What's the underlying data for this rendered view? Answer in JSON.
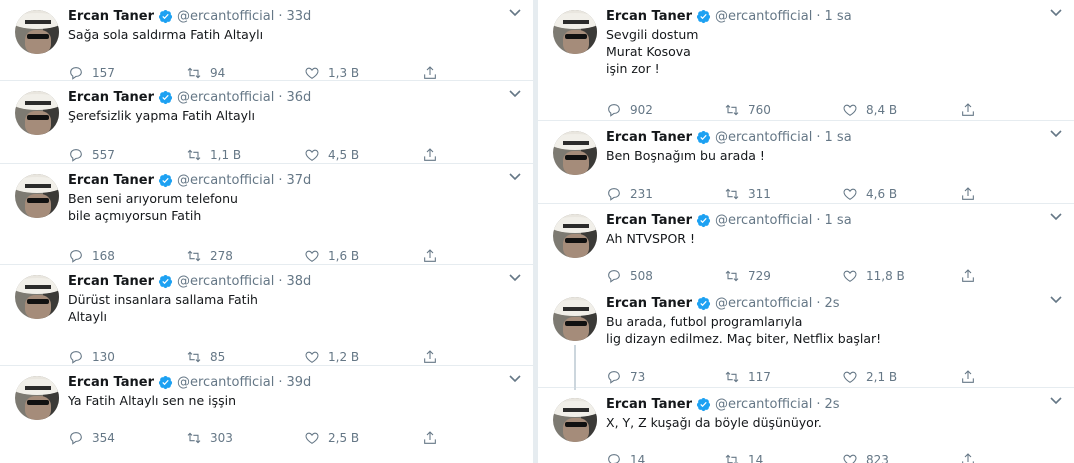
{
  "author": {
    "name": "Ercan Taner",
    "handle": "@ercantofficial"
  },
  "colors": {
    "verified": "#1da1f2",
    "muted": "#657786",
    "text": "#14171a",
    "divider": "#e6ecf0"
  },
  "left_tweets": [
    {
      "time": "33d",
      "text": "Sağa sola saldırma Fatih Altaylı",
      "replies": "157",
      "retweets": "94",
      "likes": "1,3 B"
    },
    {
      "time": "36d",
      "text": "Şerefsizlik yapma  Fatih Altaylı",
      "replies": "557",
      "retweets": "1,1 B",
      "likes": "4,5 B"
    },
    {
      "time": "37d",
      "text": "Ben seni arıyorum telefonu\nbile açmıyorsun Fatih",
      "replies": "168",
      "retweets": "278",
      "likes": "1,6 B"
    },
    {
      "time": "38d",
      "text": "Dürüst insanlara sallama Fatih\nAltaylı",
      "replies": "130",
      "retweets": "85",
      "likes": "1,2 B"
    },
    {
      "time": "39d",
      "text": "Ya Fatih  Altaylı sen ne işşin",
      "replies": "354",
      "retweets": "303",
      "likes": "2,5 B"
    }
  ],
  "right_tweets": [
    {
      "time": "1 sa",
      "text": "Sevgili dostum\nMurat Kosova\nişin zor !",
      "replies": "902",
      "retweets": "760",
      "likes": "8,4 B"
    },
    {
      "time": "1 sa",
      "text": "Ben Boşnağım bu arada !",
      "replies": "231",
      "retweets": "311",
      "likes": "4,6 B"
    },
    {
      "time": "1 sa",
      "text": "Ah NTVSPOR  !",
      "replies": "508",
      "retweets": "729",
      "likes": "11,8 B"
    },
    {
      "time": "2s",
      "text": "Bu arada, futbol programlarıyla\nlig dizayn edilmez. Maç biter, Netflix başlar!",
      "replies": "73",
      "retweets": "117",
      "likes": "2,1 B"
    },
    {
      "time": "2s",
      "text": "X, Y, Z kuşağı da böyle düşünüyor.",
      "replies": "14",
      "retweets": "14",
      "likes": "823"
    }
  ]
}
